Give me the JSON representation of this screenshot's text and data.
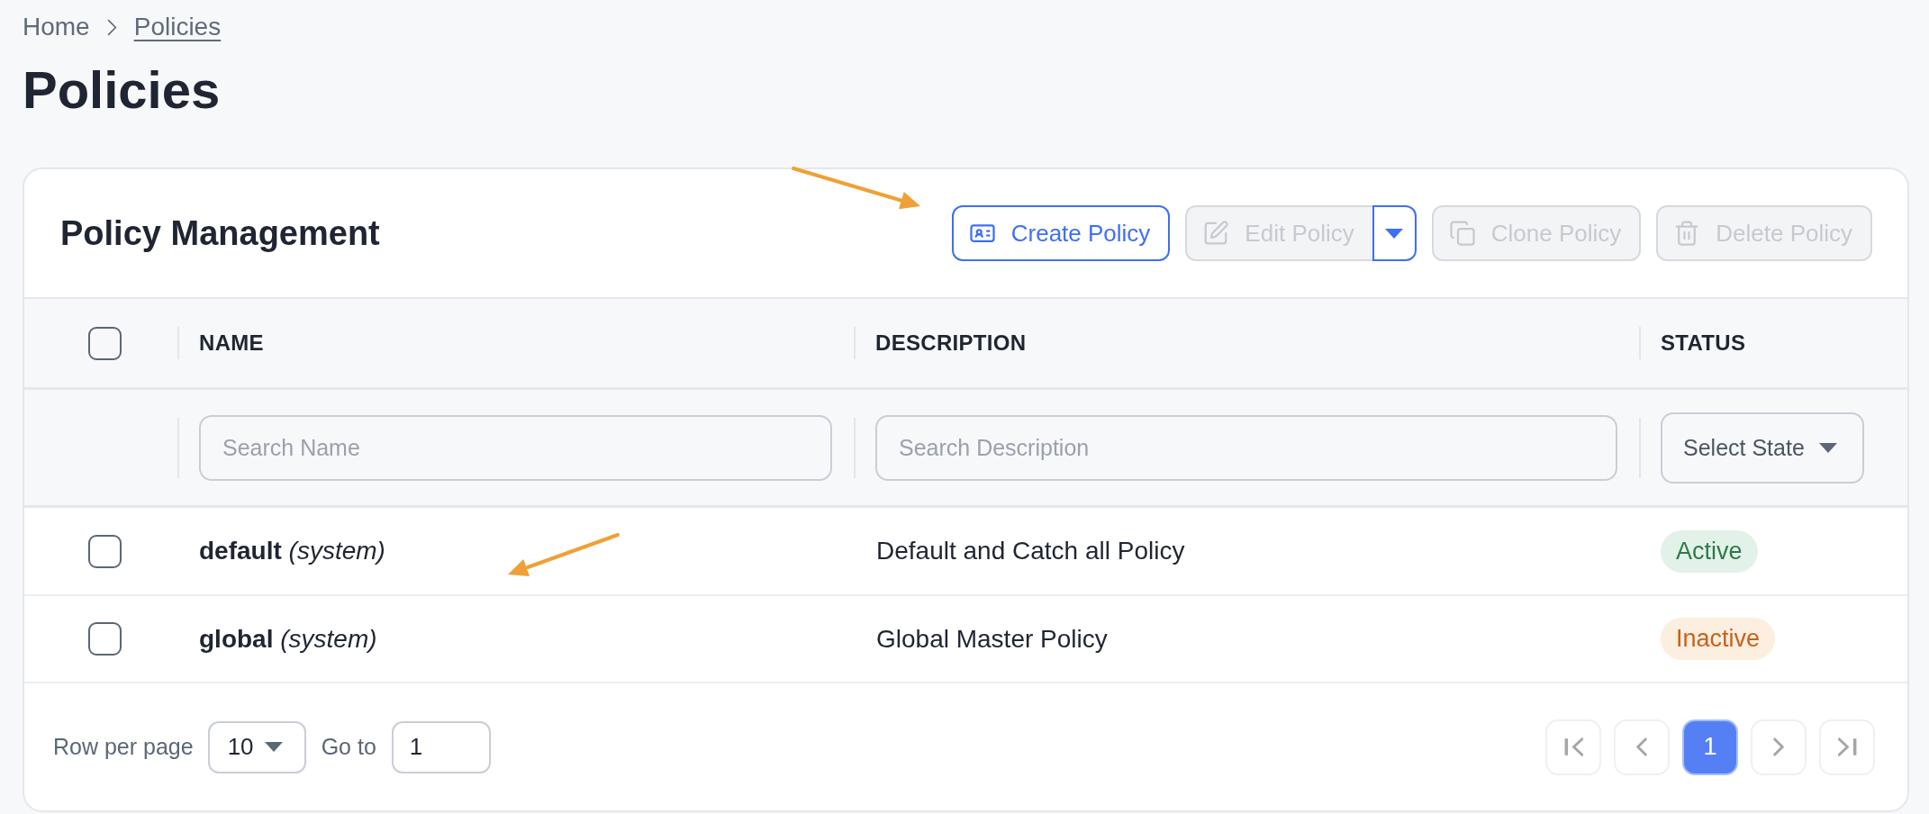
{
  "breadcrumb": [
    {
      "label": "Home",
      "current": false
    },
    {
      "label": "Policies",
      "current": true
    }
  ],
  "page_title": "Policies",
  "panel": {
    "title": "Policy Management",
    "actions": [
      {
        "kind": "create",
        "label": "Create Policy",
        "disabled": false,
        "has_menu": false
      },
      {
        "kind": "edit",
        "label": "Edit Policy",
        "disabled": true,
        "has_menu": true
      },
      {
        "kind": "clone",
        "label": "Clone Policy",
        "disabled": true,
        "has_menu": false
      },
      {
        "kind": "delete",
        "label": "Delete Policy",
        "disabled": true,
        "has_menu": false
      }
    ]
  },
  "table": {
    "select_all": {
      "checked": false
    },
    "columns": [
      {
        "label": "NAME",
        "filter": {
          "kind": "text",
          "placeholder": "Search Name"
        }
      },
      {
        "label": "DESCRIPTION",
        "filter": {
          "kind": "text",
          "placeholder": "Search Description"
        }
      },
      {
        "label": "STATUS",
        "filter": {
          "kind": "select",
          "placeholder": "Select State"
        }
      }
    ],
    "rows": [
      {
        "checked": false,
        "name": "**default** *(system)*",
        "description": "Default and Catch all Policy",
        "status": {
          "kind": "active",
          "label": "Active"
        }
      },
      {
        "checked": false,
        "name": "**global** *(system)*",
        "description": "Global Master Policy",
        "status": {
          "kind": "inactive",
          "label": "Inactive"
        }
      }
    ]
  },
  "pagination": {
    "rows_per_page_label": "Row per page",
    "rows_per_page": "10",
    "go_to_label": "Go to",
    "go_to_value": "1",
    "pages": [
      {
        "label": "1",
        "selected": true
      }
    ]
  }
}
